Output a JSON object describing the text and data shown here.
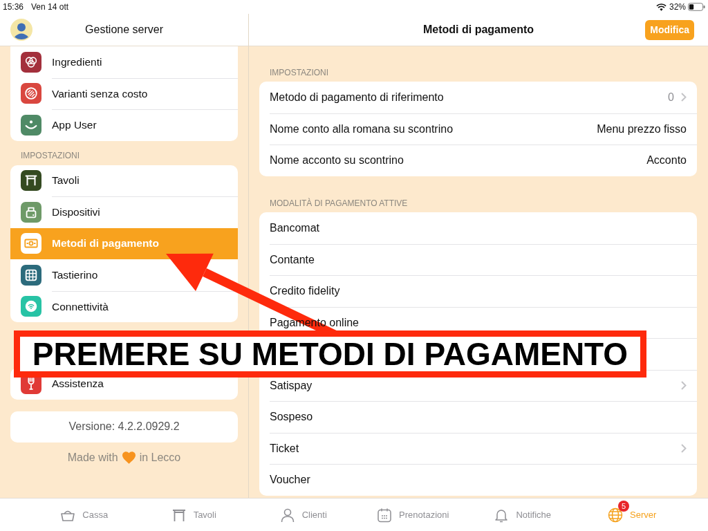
{
  "status_bar": {
    "time": "15:36",
    "date": "Ven 14 ott",
    "battery": "32%"
  },
  "sidebar": {
    "title": "Gestione server",
    "sections": [
      {
        "items": [
          {
            "label": "Ingredienti",
            "color": "#a3303c",
            "selected": false
          },
          {
            "label": "Varianti senza costo",
            "color": "#d9473f",
            "selected": false
          },
          {
            "label": "App User",
            "color": "#4f8a66",
            "selected": false
          }
        ]
      },
      {
        "header": "IMPOSTAZIONI",
        "items": [
          {
            "label": "Tavoli",
            "color": "#344a21",
            "selected": false
          },
          {
            "label": "Dispositivi",
            "color": "#6e9a68",
            "selected": false
          },
          {
            "label": "Metodi di pagamento",
            "color": "#f5a11f",
            "selected": true
          },
          {
            "label": "Tastierino",
            "color": "#2c6b7c",
            "selected": false
          },
          {
            "label": "Connettività",
            "color": "#27c3a5",
            "selected": false
          }
        ]
      },
      {
        "items": [
          {
            "label": "Assistenza",
            "color": "#e03a36",
            "selected": false
          }
        ]
      }
    ],
    "version": "Versione: 4.2.2.0929.2",
    "credit": {
      "before": "Made with",
      "after": "in Lecco"
    }
  },
  "detail": {
    "title": "Metodi di pagamento",
    "edit_button": "Modifica",
    "sections": [
      {
        "header": "IMPOSTAZIONI",
        "rows": [
          {
            "label": "Metodo di pagamento di riferimento",
            "value": "0",
            "chevron": true
          },
          {
            "label": "Nome conto alla romana su scontrino",
            "value": "Menu prezzo fisso",
            "chevron": false
          },
          {
            "label": "Nome acconto su scontrino",
            "value": "Acconto",
            "chevron": false
          }
        ]
      },
      {
        "header": "MODALITÀ DI PAGAMENTO ATTIVE",
        "rows": [
          {
            "label": "Bancomat",
            "chevron": false
          },
          {
            "label": "Contante",
            "chevron": false
          },
          {
            "label": "Credito fidelity",
            "chevron": false
          },
          {
            "label": "Pagamento online",
            "chevron": false
          },
          {
            "chevron": false
          },
          {
            "label": "Satispay",
            "chevron": true
          },
          {
            "label": "Sospeso",
            "chevron": false
          },
          {
            "label": "Ticket",
            "chevron": true
          },
          {
            "label": "Voucher",
            "chevron": false
          }
        ]
      }
    ]
  },
  "tab_bar": {
    "tabs": [
      {
        "label": "Cassa",
        "selected": false
      },
      {
        "label": "Tavoli",
        "selected": false
      },
      {
        "label": "Clienti",
        "selected": false
      },
      {
        "label": "Prenotazioni",
        "selected": false
      },
      {
        "label": "Notifiche",
        "selected": false
      },
      {
        "label": "Server",
        "selected": true,
        "badge": "5"
      }
    ]
  },
  "annotation": {
    "text": "PREMERE SU METODI DI PAGAMENTO"
  }
}
